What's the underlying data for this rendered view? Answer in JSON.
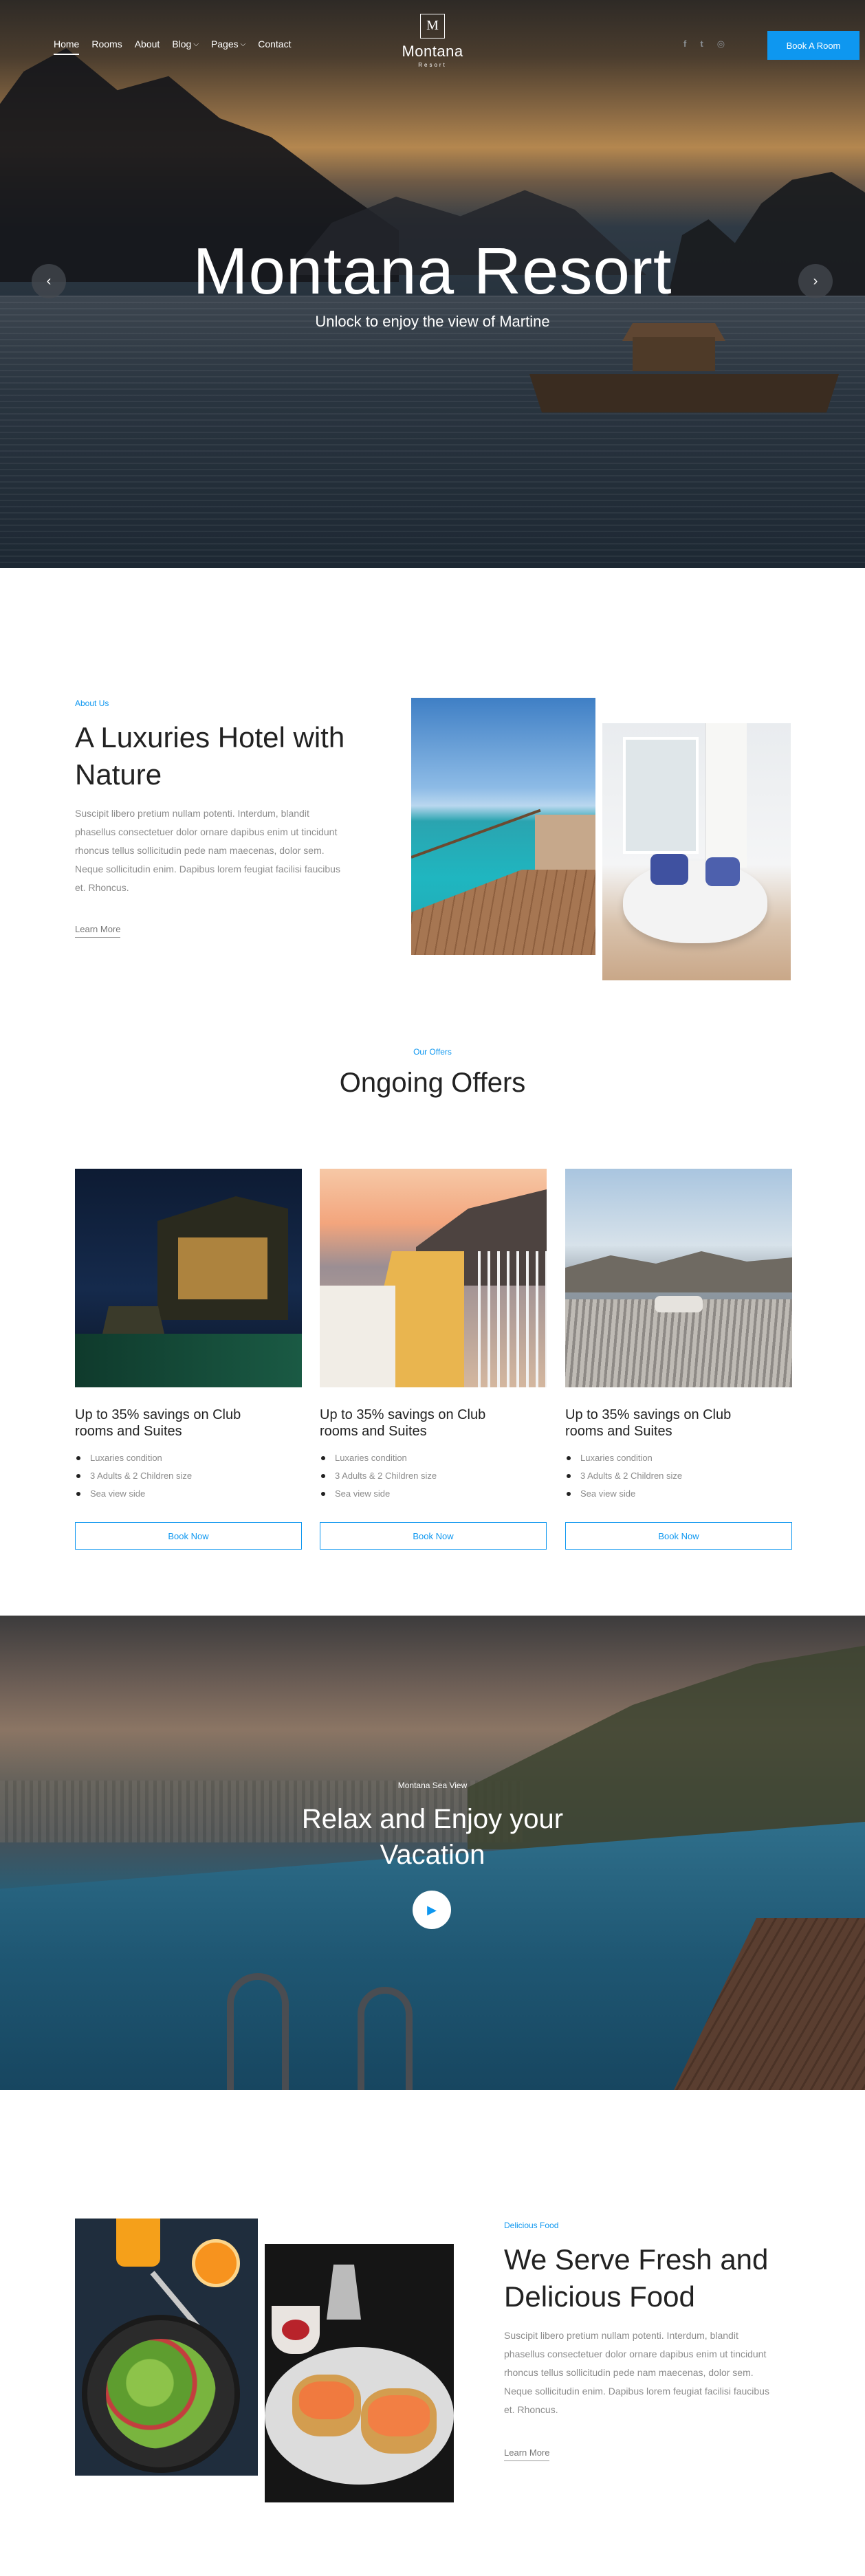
{
  "nav": {
    "items": [
      {
        "label": "Home",
        "active": true,
        "dropdown": false
      },
      {
        "label": "Rooms",
        "active": false,
        "dropdown": false
      },
      {
        "label": "About",
        "active": false,
        "dropdown": false
      },
      {
        "label": "Blog",
        "active": false,
        "dropdown": true
      },
      {
        "label": "Pages",
        "active": false,
        "dropdown": true
      },
      {
        "label": "Contact",
        "active": false,
        "dropdown": false
      }
    ]
  },
  "logo": {
    "mark": "M",
    "name": "Montana",
    "sub": "Resort"
  },
  "social": {
    "icons": [
      "facebook-icon",
      "twitter-icon",
      "instagram-icon"
    ],
    "glyphs": [
      "f",
      "t",
      "◎"
    ]
  },
  "header": {
    "cta": "Book A Room",
    "accent": "#0e97f0"
  },
  "hero": {
    "title": "Montana Resort",
    "subtitle": "Unlock to enjoy the view of Martine",
    "prev_glyph": "‹",
    "next_glyph": "›"
  },
  "about": {
    "eyebrow": "About Us",
    "title": "A Luxuries Hotel with Nature",
    "text": "Suscipit libero pretium nullam potenti. Interdum, blandit phasellus consectetuer dolor ornare dapibus enim ut tincidunt rhoncus tellus sollicitudin pede nam maecenas, dolor sem. Neque sollicitudin enim. Dapibus lorem feugiat facilisi faucibus et. Rhoncus.",
    "link": "Learn More"
  },
  "offers": {
    "eyebrow": "Our Offers",
    "title": "Ongoing Offers",
    "cards": [
      {
        "title": "Up to 35% savings on Club rooms and Suites",
        "features": [
          "Luxaries condition",
          "3 Adults & 2 Children size",
          "Sea view side"
        ],
        "button": "Book Now"
      },
      {
        "title": "Up to 35% savings on Club rooms and Suites",
        "features": [
          "Luxaries condition",
          "3 Adults & 2 Children size",
          "Sea view side"
        ],
        "button": "Book Now"
      },
      {
        "title": "Up to 35% savings on Club rooms and Suites",
        "features": [
          "Luxaries condition",
          "3 Adults & 2 Children size",
          "Sea view side"
        ],
        "button": "Book Now"
      }
    ]
  },
  "video": {
    "eyebrow": "Montana Sea View",
    "title": "Relax and Enjoy your Vacation",
    "play_glyph": "▶"
  },
  "food": {
    "eyebrow": "Delicious Food",
    "title": "We Serve Fresh and Delicious Food",
    "text": "Suscipit libero pretium nullam potenti. Interdum, blandit phasellus consectetuer dolor ornare dapibus enim ut tincidunt rhoncus tellus sollicitudin pede nam maecenas, dolor sem. Neque sollicitudin enim. Dapibus lorem feugiat facilisi faucibus et. Rhoncus.",
    "link": "Learn More"
  }
}
